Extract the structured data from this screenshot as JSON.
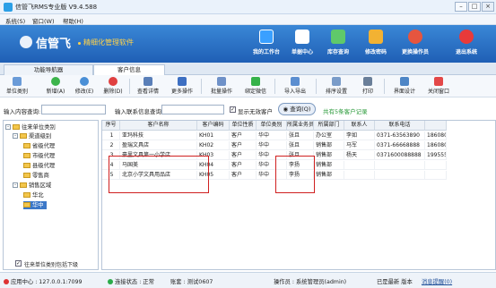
{
  "window": {
    "title": "信管飞RMS专业版 V9.4.588"
  },
  "menu": [
    "系统(S)",
    "窗口(W)",
    "帮助(H)"
  ],
  "brand": {
    "logo": "信管飞",
    "subtitle": "精细化管理软件"
  },
  "top_buttons": [
    {
      "label": "我的工作台",
      "color": "#3aa0ff",
      "icon": "desk-icon"
    },
    {
      "label": "单据中心",
      "color": "#ffffff",
      "icon": "doc-icon"
    },
    {
      "label": "库存查询",
      "color": "#5fc96a",
      "icon": "stock-icon"
    },
    {
      "label": "修改密码",
      "color": "#f2b233",
      "icon": "lock-icon"
    },
    {
      "label": "更换操作员",
      "color": "#e6553f",
      "icon": "user-icon"
    },
    {
      "label": "退出系统",
      "color": "#e83a3a",
      "icon": "exit-icon"
    }
  ],
  "tabs": [
    "功能导航器",
    "客户信息"
  ],
  "toolbar": [
    {
      "label": "单位类别",
      "icon": "category-icon",
      "color": "#6a9bd8"
    },
    {
      "label": "新增(A)",
      "icon": "add-icon",
      "color": "#3cb44b"
    },
    {
      "label": "修改(E)",
      "icon": "edit-icon",
      "color": "#4a8fd6"
    },
    {
      "label": "删除(D)",
      "icon": "delete-icon",
      "color": "#e04040"
    },
    {
      "label": "查看详情",
      "icon": "detail-icon",
      "color": "#5a7fb8"
    },
    {
      "label": "更多操作",
      "icon": "more-icon",
      "color": "#3d6fc2"
    },
    {
      "label": "批量操作",
      "icon": "batch-icon",
      "color": "#6f91c8"
    },
    {
      "label": "绑定微信",
      "icon": "wechat-icon",
      "color": "#36b24a"
    },
    {
      "label": "导入导出",
      "icon": "import-icon",
      "color": "#5b8ed0"
    },
    {
      "label": "排序设置",
      "icon": "sort-icon",
      "color": "#7a9cc9"
    },
    {
      "label": "打印",
      "icon": "print-icon",
      "color": "#6a7f99"
    },
    {
      "label": "界面设计",
      "icon": "design-icon",
      "color": "#4e86c6"
    },
    {
      "label": "关闭窗口",
      "icon": "close-window-icon",
      "color": "#e34848"
    }
  ],
  "search": {
    "content_label": "输入内容查询:",
    "contact_label": "输入联系信息查询:",
    "show_invalid_label": "显示无效客户",
    "query_label": "查询(Q)",
    "record_count": "共有5条客户记录"
  },
  "tree": {
    "root": "往来单位类别",
    "groups": [
      {
        "name": "渠道级别",
        "children": [
          "省级代理",
          "市级代理",
          "县级代理",
          "零售商"
        ]
      },
      {
        "name": "销售区域",
        "children": [
          "华北",
          "华中"
        ]
      }
    ],
    "selected": "华中",
    "footer": "往来单位类别包括下级"
  },
  "grid": {
    "columns": [
      "序号",
      "客户名称",
      "客户编码",
      "单位性质",
      "单位类别",
      "所属业务员",
      "所属部门",
      "联系人",
      "联系电话",
      ""
    ],
    "rows": [
      [
        "1",
        "亚玛科技",
        "KH01",
        "客户",
        "华中",
        "张且",
        "办公室",
        "李如",
        "0371-63563890",
        "1860806"
      ],
      [
        "2",
        "盈瑞文具店",
        "KH02",
        "客户",
        "华中",
        "张且",
        "销售部",
        "马军",
        "0371-66668888",
        "1860808"
      ],
      [
        "3",
        "豪里文具第一小学店",
        "KH03",
        "客户",
        "华中",
        "张且",
        "销售部",
        "杨天",
        "0371600088888",
        "1995559"
      ],
      [
        "4",
        "马国美",
        "KH04",
        "客户",
        "华中",
        "李扬",
        "销售部",
        "",
        "",
        ""
      ],
      [
        "5",
        "北京小学文具用品店",
        "KH05",
        "客户",
        "华中",
        "李扬",
        "销售部",
        "",
        "",
        ""
      ]
    ]
  },
  "status": {
    "server": "应用中心 : 127.0.0.1:7099",
    "conn": "连接状态 : 正常",
    "account": "账套 : 测试0607",
    "operator": "操作员 : 系统管理员(admin)",
    "version": "已是最新 版本",
    "message": "消息提醒(0)"
  }
}
